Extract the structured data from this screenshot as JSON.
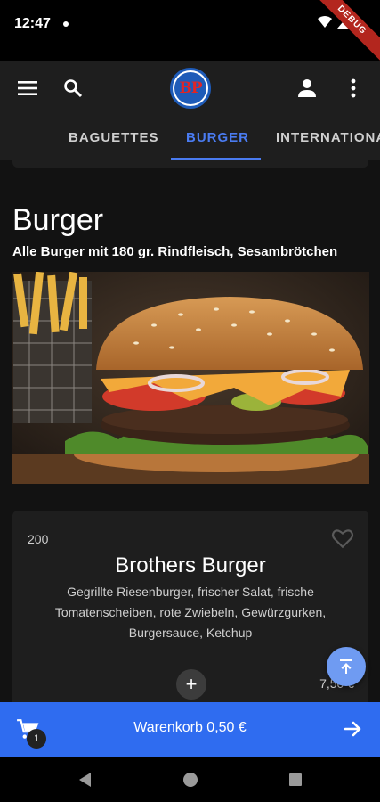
{
  "status_bar": {
    "time": "12:47",
    "debug_label": "DEBUG"
  },
  "app_bar": {
    "menu_icon": "menu-icon",
    "search_icon": "search-icon",
    "logo_text": "BP",
    "account_icon": "account-icon",
    "more_icon": "more-vert-icon"
  },
  "tabs": [
    {
      "label": "BAGUETTES",
      "active": false
    },
    {
      "label": "BURGER",
      "active": true
    },
    {
      "label": "INTERNATIONAL",
      "active": false
    }
  ],
  "category": {
    "title": "Burger",
    "subtitle": "Alle Burger mit 180 gr. Rindfleisch, Sesambrötchen"
  },
  "product": {
    "number": "200",
    "name": "Brothers Burger",
    "description": "Gegrillte Riesenburger, frischer Salat, frische Tomatenscheiben, rote Zwiebeln, Gewürzgurken, Burgersauce, Ketchup",
    "add_label": "+",
    "price": "7,50 €"
  },
  "cart": {
    "label": "Warenkorb 0,50 €",
    "count": "1"
  },
  "colors": {
    "accent": "#4a7bf0",
    "cart_bar": "#2f6cf0",
    "fab": "#6f9bf2",
    "background": "#121212",
    "surface": "#1e1e1e"
  }
}
